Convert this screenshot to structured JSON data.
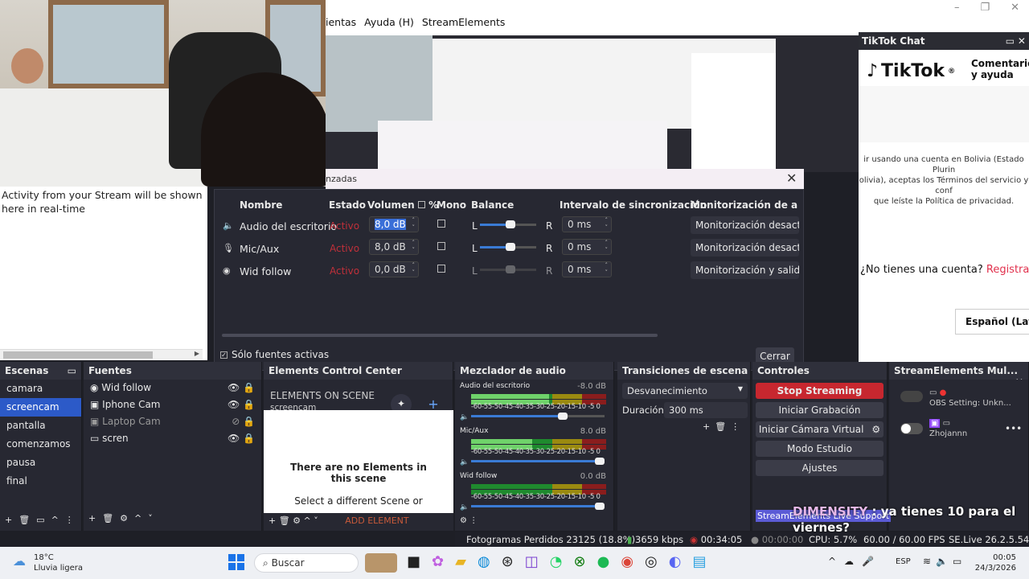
{
  "window": {
    "menu": [
      "ientas",
      "Ayuda (H)",
      "StreamElements"
    ],
    "controls": [
      "–",
      "❐",
      "✕"
    ]
  },
  "activity": {
    "text": "Activity from your Stream will be shown here in real-time"
  },
  "tiktok": {
    "panel_title": "TikTok Chat",
    "logo_text": "TikTok",
    "subtitle": "Comentarios y ayuda",
    "terms_line1": "ir usando una cuenta en Bolivia (Estado Plurin",
    "terms_line2": "olivia), aceptas los Términos del servicio y conf",
    "terms_line3": "que leíste la Política de privacidad.",
    "no_account": "¿No tienes una cuenta?",
    "register": "Registrarse",
    "language": "Español (Latino"
  },
  "dialog": {
    "title": "nzadas",
    "headers": {
      "name": "Nombre",
      "state": "Estado",
      "volume": "Volumen",
      "percent": "%",
      "mono": "Mono",
      "balance": "Balance",
      "sync": "Intervalo de sincronización",
      "monitoring": "Monitorización de audio"
    },
    "rows": [
      {
        "icon": "speaker-icon",
        "name": "Audio del escritorio",
        "state": "Activo",
        "volume": "8,0 dB",
        "sync": "0 ms",
        "monitoring": "Monitorización desactivada",
        "balance_l": "L",
        "balance_r": "R"
      },
      {
        "icon": "microphone-icon",
        "name": "Mic/Aux",
        "state": "Activo",
        "volume": "8,0 dB",
        "sync": "0 ms",
        "monitoring": "Monitorización desactivada",
        "balance_l": "L",
        "balance_r": "R"
      },
      {
        "icon": "globe-icon",
        "name": "Wid follow",
        "state": "Activo",
        "volume": "0,0 dB",
        "sync": "0 ms",
        "monitoring": "Monitorización y salida",
        "balance_l": "L",
        "balance_r": "R"
      }
    ],
    "only_active": "Sólo fuentes activas",
    "close": "Cerrar"
  },
  "scenes": {
    "title": "Escenas",
    "items": [
      "camara",
      "screencam",
      "pantalla",
      "comenzamos",
      "pausa",
      "final"
    ],
    "selected": "screencam"
  },
  "sources": {
    "title": "Fuentes",
    "items": [
      {
        "name": "Wid follow",
        "icon": "globe-icon"
      },
      {
        "name": "Iphone Cam",
        "icon": "camera-icon"
      },
      {
        "name": "Laptop Cam",
        "icon": "camera-icon"
      },
      {
        "name": "scren",
        "icon": "monitor-icon"
      }
    ]
  },
  "elements": {
    "title": "Elements Control Center",
    "on_scene": "ELEMENTS ON SCENE",
    "scene_name": "screencam",
    "empty_title": "There are no Elements in this scene",
    "empty_sub": "Select a different Scene or",
    "add_element": "ADD ELEMENT"
  },
  "mixer": {
    "title": "Mezclador de audio",
    "channels": [
      {
        "name": "Audio del escritorio",
        "db": "-8.0 dB",
        "level": 0.58,
        "vol": 0.72
      },
      {
        "name": "Mic/Aux",
        "db": "8.0 dB",
        "level": 0.45,
        "vol": 1.0
      },
      {
        "name": "Wid follow",
        "db": "0.0 dB",
        "level": 0.0,
        "vol": 1.0
      }
    ],
    "scale": "-60-55-50-45-40-35-30-25-20-15-10 -5 0"
  },
  "transitions": {
    "title": "Transiciones de escena",
    "selected": "Desvanecimiento",
    "duration_label": "Duración",
    "duration": "300 ms"
  },
  "controls": {
    "title": "Controles",
    "stop_streaming": "Stop Streaming",
    "start_recording": "Iniciar Grabación",
    "start_virtual_cam": "Iniciar Cámara Virtual",
    "studio_mode": "Modo Estudio",
    "settings": "Ajustes"
  },
  "se_panel": {
    "title": "StreamElements Mul...",
    "line1": "OBS Setting: Unkn...",
    "line2": "Zhojannn"
  },
  "status": {
    "dropped": "Fotogramas Perdidos 23125 (18.8%)",
    "kbps": "3659 kbps",
    "live_time": "00:34:05",
    "rec_time": "00:00:00",
    "cpu": "CPU: 5.7%",
    "fps": "60.00 / 60.00 FPS",
    "version": "SE.Live 26.2.5.549"
  },
  "overlay": {
    "support": "StreamElements Live Support",
    "brand": "DIMENSITY",
    "line1": ": ya tienes 10 para el",
    "line2": "viernes?"
  },
  "taskbar": {
    "temp": "18°C",
    "weather": "Lluvia ligera",
    "search": "Buscar",
    "lang": "ESP",
    "time": "00:05",
    "date": "24/3/2026"
  },
  "colors": {
    "accent": "#2c5ac8",
    "stop": "#c7272f",
    "active_state": "#c0303a",
    "register": "#e1304c"
  }
}
